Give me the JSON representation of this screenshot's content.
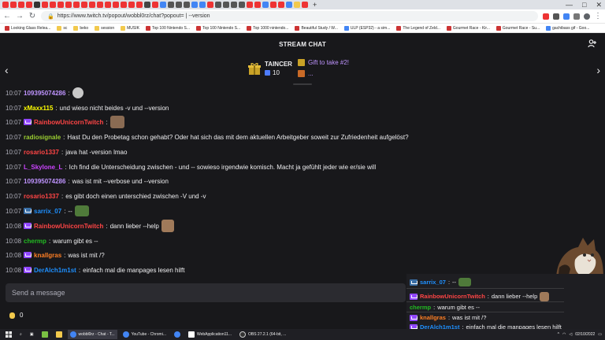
{
  "browser": {
    "url": "https://www.twitch.tv/popout/wobbl0rz/chat?popout= | --version",
    "bookmarks": [
      "Looking Glass Relea...",
      "sc",
      "beko",
      "session",
      "MUSIK",
      "Top 100 Nintendo S...",
      "Top 100 Nintendo S...",
      "Top 1000 nintendo...",
      "Beautiful Study / W...",
      "ULP (ESP32) - a sim...",
      "The Legend of Zeld...",
      "Gourmet Race - Kir...",
      "Gourmet Race - Su...",
      "gachibass gif - Goo..."
    ]
  },
  "header": {
    "title": "STREAM CHAT"
  },
  "gift": {
    "name": "TAINCER",
    "count": "10",
    "side_title": "Gift to take #2!",
    "side_sub": "..."
  },
  "messages": [
    {
      "time": "10:07",
      "user": "109395074286",
      "color": "#bf94ff",
      "badge": false,
      "text": "",
      "emote": "#c8c8c8"
    },
    {
      "time": "10:07",
      "user": "xMaxx115",
      "color": "#ffff00",
      "badge": false,
      "text": "und wieso nicht beides -v und --version",
      "emote": ""
    },
    {
      "time": "10:07",
      "user": "RainbowUnicornTwitch",
      "color": "#ff4545",
      "badge": true,
      "text": "",
      "emote": "#8a6b53"
    },
    {
      "time": "10:07",
      "user": "radiosignale",
      "color": "#9acd32",
      "badge": false,
      "text": "Hast Du den Probetag schon gehabt? Oder hat sich das mit dem aktuellen Arbeitgeber soweit zur Zufriedenheit aufgelöst?",
      "emote": ""
    },
    {
      "time": "10:07",
      "user": "rosario1337",
      "color": "#ff4545",
      "badge": false,
      "text": "java hat -version lmao",
      "emote": ""
    },
    {
      "time": "10:07",
      "user": "L_Skylone_L",
      "color": "#cc44ff",
      "badge": false,
      "text": "Ich find die Unterscheidung zwischen - und -- sowieso irgendwie komisch. Macht ja gefühlt jeder wie er/sie will",
      "emote": ""
    },
    {
      "time": "10:07",
      "user": "109395074286",
      "color": "#bf94ff",
      "badge": false,
      "text": "was ist mit --verbose und --version",
      "emote": ""
    },
    {
      "time": "10:07",
      "user": "rosario1337",
      "color": "#ff4545",
      "badge": false,
      "text": "es gibt doch einen unterschied zwischen -V und -v",
      "emote": ""
    },
    {
      "time": "10:07",
      "user": "sarrix_07",
      "color": "#1e90ff",
      "badge": true,
      "text": "--",
      "emote": "#4f7a3a"
    },
    {
      "time": "10:08",
      "user": "RainbowUnicornTwitch",
      "color": "#ff4545",
      "badge": true,
      "text": "dann lieber --help",
      "emote": "#a07a5a"
    },
    {
      "time": "10:08",
      "user": "chermp",
      "color": "#22bb22",
      "badge": false,
      "text": "warum gibt es --",
      "emote": ""
    },
    {
      "time": "10:08",
      "user": "knallgras",
      "color": "#ff7f24",
      "badge": true,
      "text": "was ist mit /?",
      "emote": ""
    },
    {
      "time": "10:08",
      "user": "DerAlch1m1st",
      "color": "#1e90ff",
      "badge": true,
      "text": "einfach mal die manpages lesen hilft",
      "emote": ""
    }
  ],
  "input": {
    "placeholder": "Send a message"
  },
  "points": {
    "value": "0"
  },
  "overlay": [
    {
      "user": "sarrix_07",
      "color": "#1e90ff",
      "text": "--"
    },
    {
      "user": "RainbowUnicornTwitch",
      "color": "#ff4545",
      "text": "dann lieber --help"
    },
    {
      "user": "chermp",
      "color": "#22bb22",
      "text": "warum gibt es --"
    },
    {
      "user": "knallgras",
      "color": "#ff7f24",
      "text": "was ist mit /?"
    },
    {
      "user": "DerAlch1m1st",
      "color": "#1e90ff",
      "text": "einfach mal die manpages lesen hilft"
    }
  ],
  "taskbar": {
    "items": [
      "wobbl0rz - Chat - T...",
      "YouTube - Chromi...",
      "WebApplication11...",
      "OBS 27.2.1 (64-bit, ..."
    ],
    "date": "02/10/2022"
  }
}
